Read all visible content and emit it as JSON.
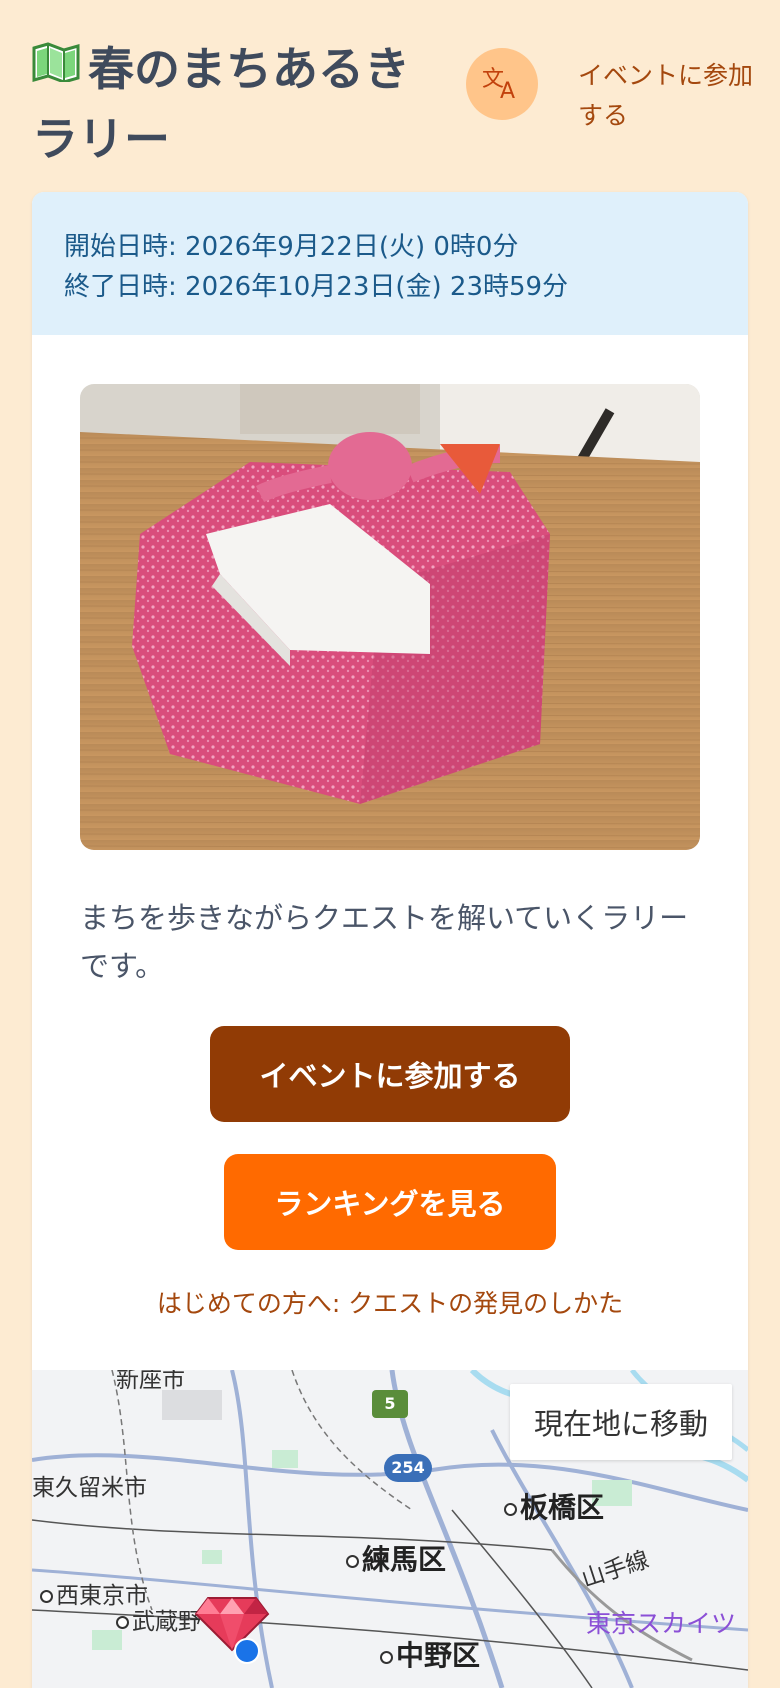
{
  "header": {
    "title": "春のまちあるきラリー",
    "title_icon": "map-icon",
    "translate_icon": "translate-icon",
    "join_link": "イベントに参加する"
  },
  "event": {
    "start": "開始日時: 2026年9月22日(火) 0時0分",
    "end": "終了日時: 2026年10月23日(金) 23時59分",
    "description": "まちを歩きながらクエストを解いていくラリーです。"
  },
  "actions": {
    "join_button": "イベントに参加する",
    "ranking_button": "ランキングを見る",
    "guide_link": "はじめての方へ: クエストの発見のしかた"
  },
  "map": {
    "locate_button": "現在地に移動",
    "labels": {
      "higashikurume": "東久留米市",
      "nishitokyo": "西東京市",
      "musashino": "武蔵野",
      "nerima": "練馬区",
      "itabashi": "板橋区",
      "nakano": "中野区",
      "yamanote": "山手線",
      "skytree": "東京スカイツ",
      "shinza": "新座市"
    },
    "route_shields": [
      "5",
      "254"
    ],
    "marker_icon": "gem-icon"
  },
  "colors": {
    "background": "#fdebd2",
    "primary_dark": "#913b05",
    "primary": "#ff6a00",
    "date_bg": "#dff0fb",
    "date_text": "#1b5a8a"
  }
}
